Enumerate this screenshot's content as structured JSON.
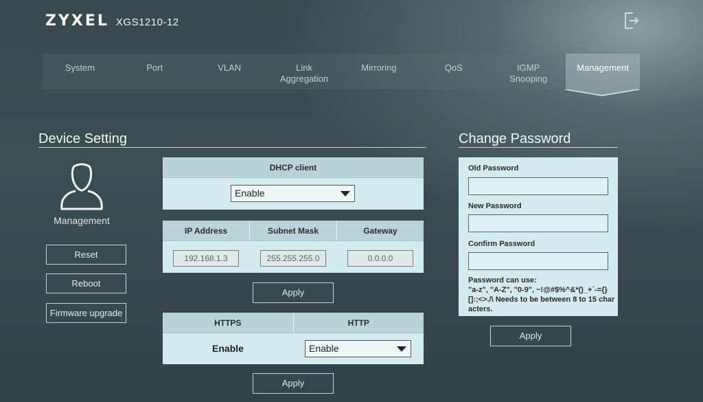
{
  "brand": {
    "logo": "ZYXEL",
    "model": "XGS1210-12"
  },
  "tabs": [
    {
      "label": "System"
    },
    {
      "label": "Port"
    },
    {
      "label": "VLAN"
    },
    {
      "label": "Link\nAggregation"
    },
    {
      "label": "Mirroring"
    },
    {
      "label": "QoS"
    },
    {
      "label": "IGMP\nSnooping"
    },
    {
      "label": "Management"
    }
  ],
  "device_setting": {
    "title": "Device Setting",
    "user_label": "Management",
    "buttons": {
      "reset": "Reset",
      "reboot": "Reboot",
      "firmware": "Firmware upgrade"
    },
    "dhcp": {
      "header": "DHCP client",
      "value": "Enable"
    },
    "ip": {
      "headers": [
        "IP Address",
        "Subnet Mask",
        "Gateway"
      ],
      "values": [
        "192.168.1.3",
        "255.255.255.0",
        "0.0.0.0"
      ]
    },
    "apply_label": "Apply",
    "web": {
      "headers": [
        "HTTPS",
        "HTTP"
      ],
      "https_value": "Enable",
      "http_value": "Enable"
    },
    "apply2_label": "Apply"
  },
  "change_password": {
    "title": "Change Password",
    "old_label": "Old Password",
    "new_label": "New Password",
    "confirm_label": "Confirm Password",
    "note": "Password can use:\n\"a-z\", \"A-Z\", \"0-9\", ~!@#$%^&*()_+`-={}[]:;<>./\\ Needs to be between 8 to 15 characters.",
    "apply_label": "Apply"
  }
}
